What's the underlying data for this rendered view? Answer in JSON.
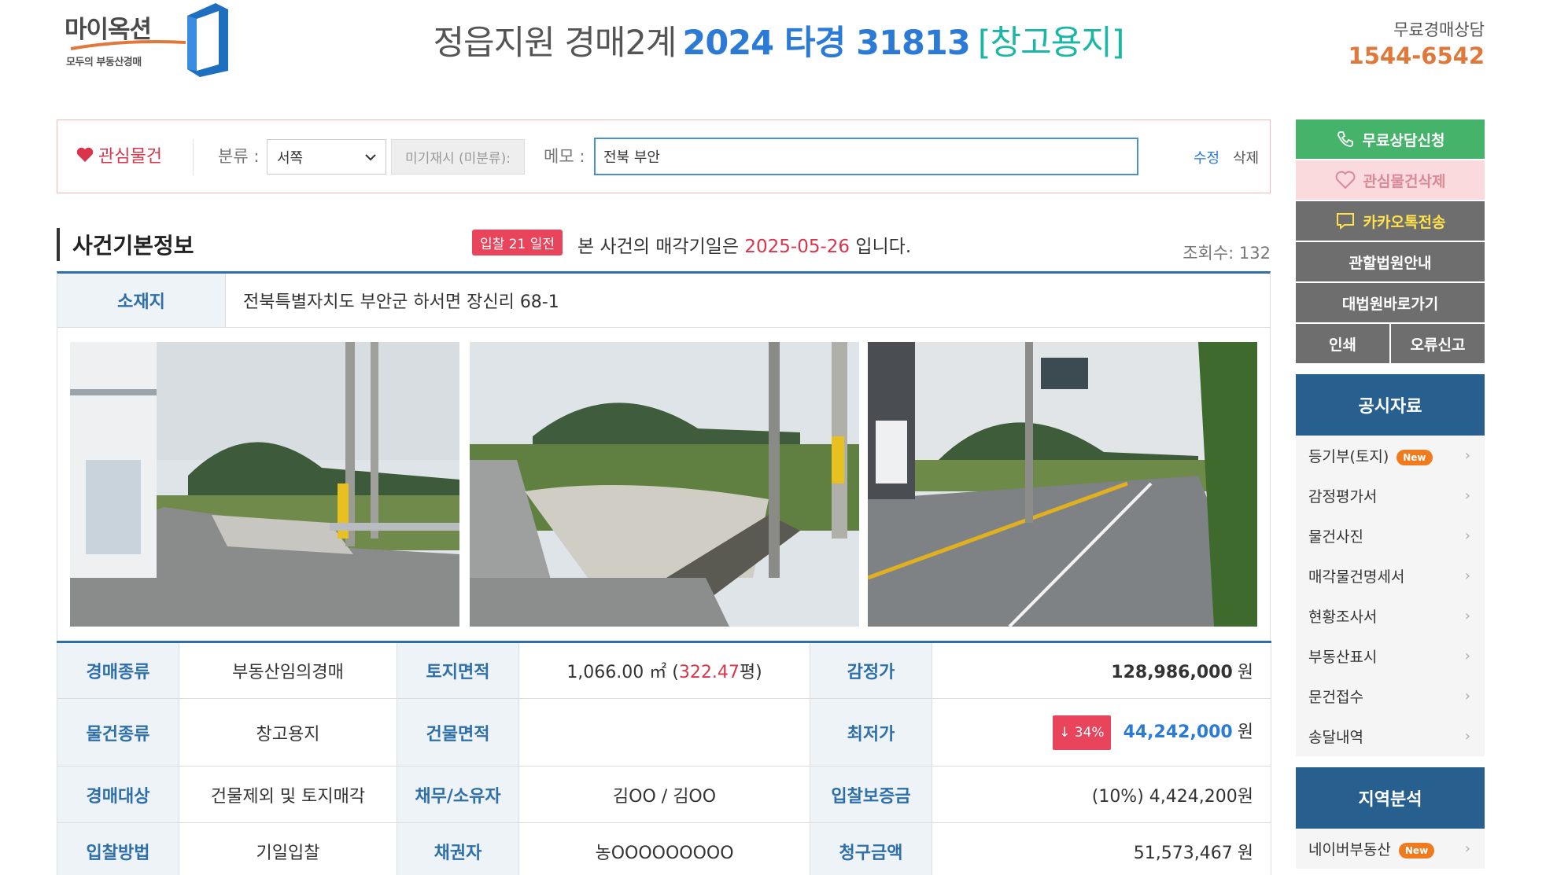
{
  "brand": {
    "name": "마이옥션",
    "tagline": "모두의 부동산경매",
    "colors": {
      "orange": "#e0783a",
      "blue": "#2a7ad6",
      "navy": "#275f8e",
      "red": "#d8354c",
      "green": "#45b46a",
      "teal": "#1bb6a6"
    }
  },
  "header": {
    "court": "정읍지원 경매2계",
    "case_no": "2024 타경 31813",
    "property_type": "[창고용지]"
  },
  "hotline": {
    "label": "무료경매상담",
    "number": "1544-6542"
  },
  "interest_bar": {
    "fav_label": "관심물건",
    "category_label": "분류 :",
    "category_value": "서쪽",
    "unset_label": "미기재시 (미분류):",
    "memo_label": "메모 :",
    "memo_value": "전북 부안",
    "edit_label": "수정",
    "delete_label": "삭제"
  },
  "section": {
    "title": "사건기본정보",
    "bid_badge": "입찰 21 일전",
    "sale_prefix": "본 사건의 매각기일은",
    "sale_date": "2025-05-26",
    "sale_suffix": "입니다.",
    "views": "조회수: 132"
  },
  "location": {
    "label": "소재지",
    "value": "전북특별자치도 부안군 하서면 장신리 68-1"
  },
  "details": {
    "auction_kind_label": "경매종류",
    "auction_kind": "부동산임의경매",
    "land_area_label": "토지면적",
    "land_area_sqm": "1,066.00 ㎡ (",
    "land_area_pyeong": "322.47",
    "land_area_unit": "평)",
    "appraisal_label": "감정가",
    "appraisal": "128,986,000",
    "appraisal_unit": "원",
    "item_kind_label": "물건종류",
    "item_kind": "창고용지",
    "building_area_label": "건물면적",
    "building_area": "",
    "min_price_label": "최저가",
    "min_price_drop": "↓ 34%",
    "min_price": "44,242,000",
    "min_price_unit": "원",
    "target_label": "경매대상",
    "target": "건물제외 및 토지매각",
    "owner_label": "채무/소유자",
    "owner": "김OO / 김OO",
    "deposit_label": "입찰보증금",
    "deposit": "(10%) 4,424,200원",
    "bid_method_label": "입찰방법",
    "bid_method": "기일입찰",
    "creditor_label": "채권자",
    "creditor": "농OOOOOOOOO",
    "claim_label": "청구금액",
    "claim": "51,573,467",
    "claim_unit": "원"
  },
  "sidebar": {
    "consult": "무료상담신청",
    "unfav": "관심물건삭제",
    "kakao": "카카오톡전송",
    "court_info": "관할법원안내",
    "supreme_court": "대법원바로가기",
    "print": "인쇄",
    "report": "오류신고",
    "public_docs_title": "공시자료",
    "public_docs": [
      {
        "label": "등기부(토지)",
        "badge": "New"
      },
      {
        "label": "감정평가서"
      },
      {
        "label": "물건사진"
      },
      {
        "label": "매각물건명세서"
      },
      {
        "label": "현황조사서"
      },
      {
        "label": "부동산표시"
      },
      {
        "label": "문건접수"
      },
      {
        "label": "송달내역"
      }
    ],
    "region_title": "지역분석",
    "region_items": [
      {
        "label": "네이버부동산",
        "badge": "New"
      }
    ]
  }
}
